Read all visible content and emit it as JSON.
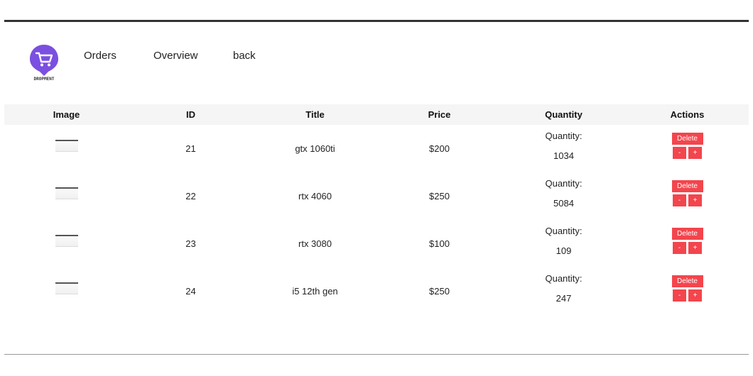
{
  "nav": {
    "logo_text": "DROPMENT",
    "links": [
      "Orders",
      "Overview",
      "back"
    ]
  },
  "table": {
    "headers": [
      "Image",
      "ID",
      "Title",
      "Price",
      "Quantity",
      "Actions"
    ],
    "rows": [
      {
        "id": "21",
        "title": "gtx 1060ti",
        "price": "$200",
        "quantity_label": "Quantity:",
        "quantity": "1034"
      },
      {
        "id": "22",
        "title": "rtx 4060",
        "price": "$250",
        "quantity_label": "Quantity:",
        "quantity": "5084"
      },
      {
        "id": "23",
        "title": "rtx 3080",
        "price": "$100",
        "quantity_label": "Quantity:",
        "quantity": "109"
      },
      {
        "id": "24",
        "title": "i5 12th gen",
        "price": "$250",
        "quantity_label": "Quantity:",
        "quantity": "247"
      }
    ],
    "delete_label": "Delete",
    "minus_label": "-",
    "plus_label": "+"
  },
  "colors": {
    "accent_button": "#f3454d",
    "logo_purple": "#7b4fe0",
    "header_bg": "#f5f5f5"
  },
  "icons": {
    "logo": "cart-pin-icon",
    "row_image": "product-thumbnail"
  }
}
